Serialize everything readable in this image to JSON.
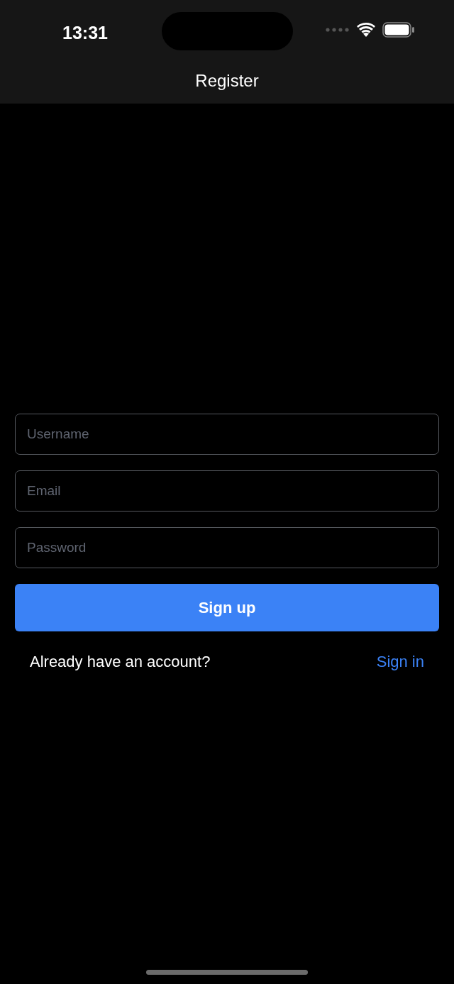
{
  "status_bar": {
    "time": "13:31"
  },
  "header": {
    "title": "Register"
  },
  "fields": [
    {
      "placeholder": "Username"
    },
    {
      "placeholder": "Email"
    },
    {
      "placeholder": "Password"
    }
  ],
  "submit": {
    "label": "Sign up"
  },
  "footer": {
    "prompt": "Already have an account?",
    "link": "Sign in"
  }
}
